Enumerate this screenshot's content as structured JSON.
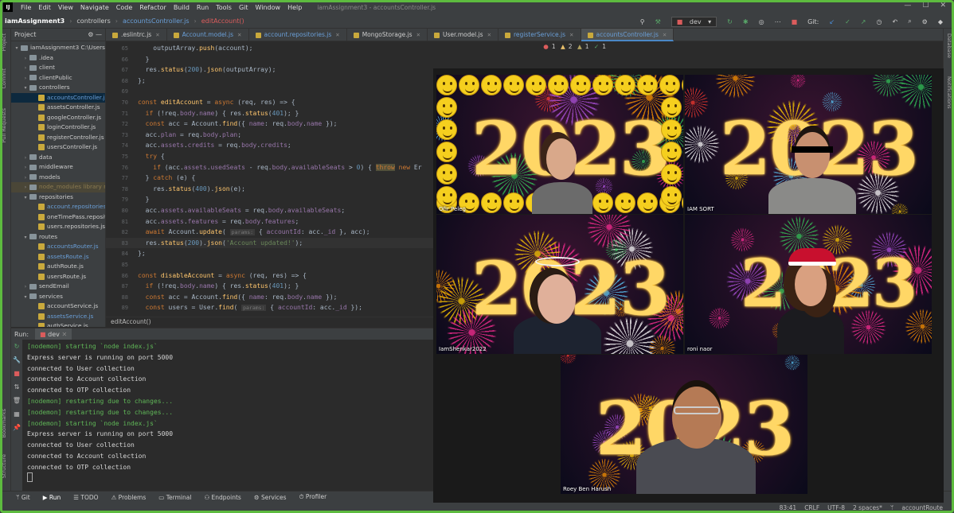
{
  "menubar": {
    "logo": "IJ",
    "items": [
      "File",
      "Edit",
      "View",
      "Navigate",
      "Code",
      "Refactor",
      "Build",
      "Run",
      "Tools",
      "Git",
      "Window",
      "Help"
    ],
    "window_title": "iamAssignment3 - accountsController.js"
  },
  "navbar": {
    "crumbs": [
      "iamAssignment3",
      "controllers",
      "accountsController.js",
      "editAccount()"
    ],
    "run_config": "dev",
    "git_label": "Git:"
  },
  "project": {
    "header": "Project",
    "tree": [
      {
        "label": "iamAssignment3  C:\\Users\\",
        "indent": 0,
        "type": "folder",
        "open": true
      },
      {
        "label": ".idea",
        "indent": 1,
        "type": "folder"
      },
      {
        "label": "client",
        "indent": 1,
        "type": "folder"
      },
      {
        "label": "clientPublic",
        "indent": 1,
        "type": "folder"
      },
      {
        "label": "controllers",
        "indent": 1,
        "type": "folder",
        "open": true
      },
      {
        "label": "accountsController.js",
        "indent": 2,
        "type": "js",
        "cls": "blue sel"
      },
      {
        "label": "assetsController.js",
        "indent": 2,
        "type": "js"
      },
      {
        "label": "googleController.js",
        "indent": 2,
        "type": "js"
      },
      {
        "label": "loginController.js",
        "indent": 2,
        "type": "js"
      },
      {
        "label": "registerController.js",
        "indent": 2,
        "type": "js"
      },
      {
        "label": "usersController.js",
        "indent": 2,
        "type": "js"
      },
      {
        "label": "data",
        "indent": 1,
        "type": "folder"
      },
      {
        "label": "middleware",
        "indent": 1,
        "type": "folder"
      },
      {
        "label": "models",
        "indent": 1,
        "type": "folder"
      },
      {
        "label": "node_modules  library root",
        "indent": 1,
        "type": "folder",
        "cls": "excl"
      },
      {
        "label": "repositories",
        "indent": 1,
        "type": "folder",
        "open": true
      },
      {
        "label": "account.repositories.js",
        "indent": 2,
        "type": "js",
        "cls": "blue"
      },
      {
        "label": "oneTimePass.repositories.js",
        "indent": 2,
        "type": "js"
      },
      {
        "label": "users.repositories.js",
        "indent": 2,
        "type": "js"
      },
      {
        "label": "routes",
        "indent": 1,
        "type": "folder",
        "open": true
      },
      {
        "label": "accountsRouter.js",
        "indent": 2,
        "type": "js",
        "cls": "blue"
      },
      {
        "label": "assetsRoute.js",
        "indent": 2,
        "type": "js",
        "cls": "blue"
      },
      {
        "label": "authRoute.js",
        "indent": 2,
        "type": "js"
      },
      {
        "label": "usersRoute.js",
        "indent": 2,
        "type": "js"
      },
      {
        "label": "sendEmail",
        "indent": 1,
        "type": "folder"
      },
      {
        "label": "services",
        "indent": 1,
        "type": "folder",
        "open": true
      },
      {
        "label": "accountService.js",
        "indent": 2,
        "type": "js"
      },
      {
        "label": "assetsService.js",
        "indent": 2,
        "type": "js",
        "cls": "blue"
      },
      {
        "label": "authService.js",
        "indent": 2,
        "type": "js"
      }
    ]
  },
  "tabs": [
    {
      "label": ".eslintrc.js",
      "cls": ""
    },
    {
      "label": "Account.model.js",
      "cls": "blue"
    },
    {
      "label": "account.repositories.js",
      "cls": "blue"
    },
    {
      "label": "MongoStorage.js",
      "cls": ""
    },
    {
      "label": "User.model.js",
      "cls": ""
    },
    {
      "label": "registerService.js",
      "cls": "blue"
    },
    {
      "label": "accountsController.js",
      "cls": "blue active"
    }
  ],
  "editor": {
    "problems": {
      "errors": "1",
      "warnings": "2",
      "weak": "1",
      "ok": "1"
    },
    "lines": [
      {
        "n": "65",
        "html": "    outputArray.<span class='fn'>push</span>(account);"
      },
      {
        "n": "66",
        "html": "  }"
      },
      {
        "n": "67",
        "html": "  res.<span class='fn'>status</span>(<span class='num'>200</span>).<span class='fn'>json</span>(outputArray);"
      },
      {
        "n": "68",
        "html": "};"
      },
      {
        "n": "69",
        "html": ""
      },
      {
        "n": "70",
        "html": "<span class='kw'>const</span> <span class='fn'>editAccount</span> = <span class='kw'>async</span> (req, res) => {"
      },
      {
        "n": "71",
        "html": "  <span class='kw'>if</span> (!req.<span class='prop'>body</span>.<span class='prop'>name</span>) { res.<span class='fn'>status</span>(<span class='num'>401</span>); }"
      },
      {
        "n": "72",
        "html": "  <span class='kw'>const</span> acc = Account.<span class='fn'>find</span>({ <span class='prop'>name</span>: req.<span class='prop'>body</span>.<span class='prop'>name</span> });"
      },
      {
        "n": "73",
        "html": "  acc.<span class='prop'>plan</span> = req.<span class='prop'>body</span>.<span class='prop'>plan</span>;"
      },
      {
        "n": "74",
        "html": "  acc.<span class='prop'>assets</span>.<span class='prop'>credits</span> = req.<span class='prop'>body</span>.<span class='prop'>credits</span>;"
      },
      {
        "n": "75",
        "html": "  <span class='kw'>try</span> {"
      },
      {
        "n": "76",
        "html": "    <span class='kw'>if</span> (acc.<span class='prop'>assets</span>.<span class='prop'>usedSeats</span> - req.<span class='prop'>body</span>.<span class='prop'>availableSeats</span> > <span class='num'>0</span>) { <span class='kw' style='background:#52503a'>throw</span> <span class='kw'>new</span> Er"
      },
      {
        "n": "77",
        "html": "  } <span class='kw'>catch</span> (e) {"
      },
      {
        "n": "78",
        "html": "    res.<span class='fn'>status</span>(<span class='num'>400</span>).<span class='fn'>json</span>(e);"
      },
      {
        "n": "79",
        "html": "  }"
      },
      {
        "n": "80",
        "html": "  acc.<span class='prop'>assets</span>.<span class='prop'>availableSeats</span> = req.<span class='prop'>body</span>.<span class='prop'>availableSeats</span>;"
      },
      {
        "n": "81",
        "html": "  acc.<span class='prop'>assets</span>.<span class='prop'>features</span> = req.<span class='prop'>body</span>.<span class='prop'>features</span>;"
      },
      {
        "n": "82",
        "html": "  <span class='kw'>await</span> Account.<span class='fn'>update</span>( <span class='hint'>params:</span> { <span class='prop'>accountId</span>: acc.<span class='prop'>_id</span> }, acc);"
      },
      {
        "n": "83",
        "html": "  res.<span class='fn'>status</span>(<span class='num'>200</span>).<span class='fn'>json</span>(<span class='str'>'Account updated!'</span>);"
      },
      {
        "n": "84",
        "html": "};"
      },
      {
        "n": "85",
        "html": ""
      },
      {
        "n": "86",
        "html": "<span class='kw'>const</span> <span class='fn'>disableAccount</span> = <span class='kw'>async</span> (req, res) => {"
      },
      {
        "n": "87",
        "html": "  <span class='kw'>if</span> (!req.<span class='prop'>body</span>.<span class='prop'>name</span>) { res.<span class='fn'>status</span>(<span class='num'>401</span>); }"
      },
      {
        "n": "88",
        "html": "  <span class='kw'>const</span> acc = Account.<span class='fn'>find</span>({ <span class='prop'>name</span>: req.<span class='prop'>body</span>.<span class='prop'>name</span> });"
      },
      {
        "n": "89",
        "html": "  <span class='kw'>const</span> users = User.<span class='fn'>find</span>( <span class='hint'>params:</span> { <span class='prop'>accountId</span>: acc.<span class='prop'>_id</span> });"
      }
    ],
    "breadcrumb": "editAccount()"
  },
  "run": {
    "label": "Run:",
    "tab": "dev",
    "lines": [
      {
        "t": "[nodemon] starting `node index.js`",
        "c": "nm"
      },
      {
        "t": "Express server is running on port 5000",
        "c": ""
      },
      {
        "t": "connected to User collection",
        "c": ""
      },
      {
        "t": "connected to Account collection",
        "c": ""
      },
      {
        "t": "connected to OTP collection",
        "c": ""
      },
      {
        "t": "[nodemon] restarting due to changes...",
        "c": "nm"
      },
      {
        "t": "[nodemon] restarting due to changes...",
        "c": "nm"
      },
      {
        "t": "[nodemon] starting `node index.js`",
        "c": "nm"
      },
      {
        "t": "Express server is running on port 5000",
        "c": ""
      },
      {
        "t": "connected to User collection",
        "c": ""
      },
      {
        "t": "connected to Account collection",
        "c": ""
      },
      {
        "t": "connected to OTP collection",
        "c": ""
      }
    ]
  },
  "bottom_tools": [
    "Git",
    "Run",
    "TODO",
    "Problems",
    "Terminal",
    "Endpoints",
    "Services",
    "Profiler"
  ],
  "statusbar": {
    "pos": "83:41",
    "eol": "CRLF",
    "enc": "UTF-8",
    "indent": "2 spaces*",
    "branch": "accountRoute"
  },
  "side_labels": {
    "left": [
      "Project",
      "Commit",
      "Pull Requests",
      "Bookmarks",
      "Structure"
    ],
    "right": [
      "Database",
      "Notifications"
    ]
  },
  "video_call": {
    "participants": [
      {
        "name": "Ofir Peleg",
        "year": "2023"
      },
      {
        "name": "IAM SORT",
        "year": "2023"
      },
      {
        "name": "IamShenkar2022",
        "year": "2023"
      },
      {
        "name": "roni naor",
        "year": "2023",
        "speaking": true
      },
      {
        "name": "Roey Ben Harush",
        "year": "2023"
      }
    ]
  }
}
